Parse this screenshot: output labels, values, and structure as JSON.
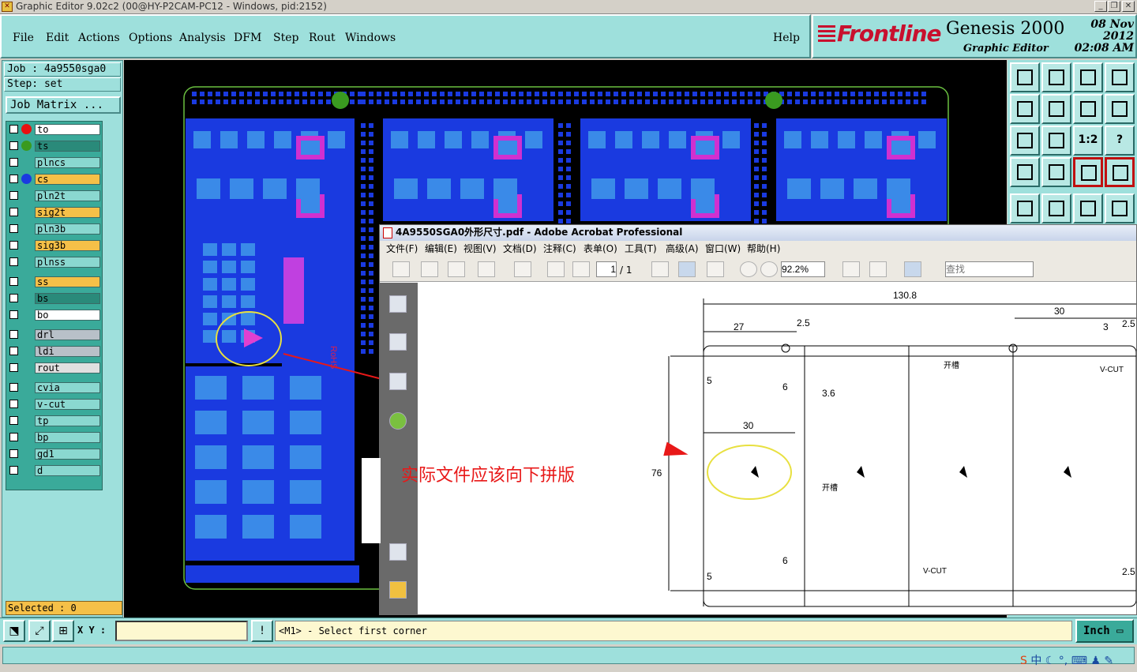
{
  "window": {
    "title": "Graphic Editor 9.02c2 (00@HY-P2CAM-PC12 - Windows, pid:2152)"
  },
  "menu": [
    "File",
    "Edit",
    "Actions",
    "Options",
    "Analysis",
    "DFM",
    "Step",
    "Rout",
    "Windows"
  ],
  "help": "Help",
  "brand": {
    "logo": "Frontline",
    "product": "Genesis 2000",
    "subtitle": "Graphic Editor",
    "date": "08 Nov 2012",
    "time": "02:08 AM"
  },
  "job": {
    "job_line": "Job : 4a9550sga0",
    "step_line": "Step: set",
    "matrix_button": "Job Matrix ..."
  },
  "layers": [
    {
      "name": "to",
      "dot": "#e81010",
      "bg": "#ffffff"
    },
    {
      "name": "ts",
      "dot": "#3a9a20",
      "bg": "#2a8a7a"
    },
    {
      "name": "plncs",
      "dot": "",
      "bg": "#8ad8d0"
    },
    {
      "name": "cs",
      "dot": "#1a3ae0",
      "bg": "#f5c048"
    },
    {
      "name": "pln2t",
      "dot": "",
      "bg": "#8ad8d0"
    },
    {
      "name": "sig2t",
      "dot": "",
      "bg": "#f5c048"
    },
    {
      "name": "pln3b",
      "dot": "",
      "bg": "#8ad8d0"
    },
    {
      "name": "sig3b",
      "dot": "",
      "bg": "#f5c048"
    },
    {
      "name": "plnss",
      "dot": "",
      "bg": "#8ad8d0"
    },
    {
      "name": "ss",
      "dot": "",
      "bg": "#f5c048"
    },
    {
      "name": "bs",
      "dot": "",
      "bg": "#2a8a7a"
    },
    {
      "name": "bo",
      "dot": "",
      "bg": "#ffffff"
    },
    {
      "name": "drl",
      "dot": "",
      "bg": "#b8c0c8"
    },
    {
      "name": "ldi",
      "dot": "",
      "bg": "#b8c0c8"
    },
    {
      "name": "rout",
      "dot": "",
      "bg": "#e0e0e0"
    },
    {
      "name": "cvia",
      "dot": "",
      "bg": "#8ad8d0"
    },
    {
      "name": "v-cut",
      "dot": "",
      "bg": "#8ad8d0"
    },
    {
      "name": "tp",
      "dot": "",
      "bg": "#8ad8d0"
    },
    {
      "name": "bp",
      "dot": "",
      "bg": "#8ad8d0"
    },
    {
      "name": "gd1",
      "dot": "",
      "bg": "#8ad8d0"
    },
    {
      "name": "d",
      "dot": "",
      "bg": "#8ad8d0"
    }
  ],
  "selected": "Selected : 0",
  "annotation": "实际文件应该向下拼版",
  "board_text": {
    "rohs": "RoHS"
  },
  "acrobat": {
    "title": "4A9550SGA0外形尺寸.pdf - Adobe Acrobat Professional",
    "menu": [
      "文件(F)",
      "编辑(E)",
      "视图(V)",
      "文档(D)",
      "注释(C)",
      "表单(O)",
      "工具(T)",
      "高级(A)",
      "窗口(W)",
      "帮助(H)"
    ],
    "page_current": "1",
    "page_total": "/ 1",
    "zoom": "92.2%",
    "search_placeholder": "查找",
    "drawing": {
      "d1": "130.8",
      "d2": "27",
      "d3": "2.5",
      "d4": "30",
      "d5": "3",
      "d6": "2.5",
      "d7": "5",
      "d8": "6",
      "d9": "3.6",
      "d10": "30",
      "d11": "76",
      "d12": "6",
      "d13": "5",
      "d14": "2.5",
      "l_slot1": "开槽",
      "l_slot2": "开槽",
      "l_vcut1": "V-CUT",
      "l_vcut2": "V-CUT"
    }
  },
  "cmd": {
    "xy_label": "X Y :",
    "message": "<M1> - Select first corner",
    "units": "Inch"
  },
  "tray": "中"
}
